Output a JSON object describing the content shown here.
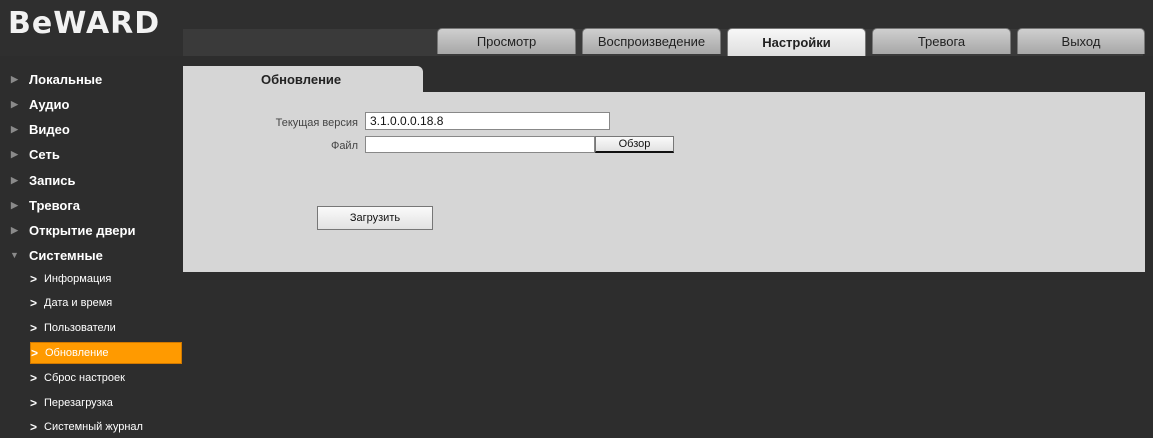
{
  "brand": {
    "logo_text": "BeWARD"
  },
  "nav_tabs": [
    {
      "label": "Просмотр",
      "active": false
    },
    {
      "label": "Воспроизведение",
      "active": false
    },
    {
      "label": "Настройки",
      "active": true
    },
    {
      "label": "Тревога",
      "active": false
    },
    {
      "label": "Выход",
      "active": false
    }
  ],
  "sidebar": {
    "categories": [
      {
        "label": "Локальные",
        "expanded": false
      },
      {
        "label": "Аудио",
        "expanded": false
      },
      {
        "label": "Видео",
        "expanded": false
      },
      {
        "label": "Сеть",
        "expanded": false
      },
      {
        "label": "Запись",
        "expanded": false
      },
      {
        "label": "Тревога",
        "expanded": false
      },
      {
        "label": "Открытие двери",
        "expanded": false
      },
      {
        "label": "Системные",
        "expanded": true
      }
    ],
    "subitems": [
      {
        "label": "Информация",
        "active": false
      },
      {
        "label": "Дата и время",
        "active": false
      },
      {
        "label": "Пользователи",
        "active": false
      },
      {
        "label": "Обновление",
        "active": true
      },
      {
        "label": "Сброс настроек",
        "active": false
      },
      {
        "label": "Перезагрузка",
        "active": false
      },
      {
        "label": "Системный журнал",
        "active": false
      }
    ]
  },
  "section": {
    "tab_label": "Обновление",
    "current_version_label": "Текущая версия",
    "current_version_value": "3.1.0.0.0.18.8",
    "file_label": "Файл",
    "file_value": "",
    "browse_label": "Обзор",
    "upload_label": "Загрузить"
  },
  "colors": {
    "accent": "#ff9a00",
    "background": "#2d2d2d",
    "panel": "#d6d6d6"
  }
}
